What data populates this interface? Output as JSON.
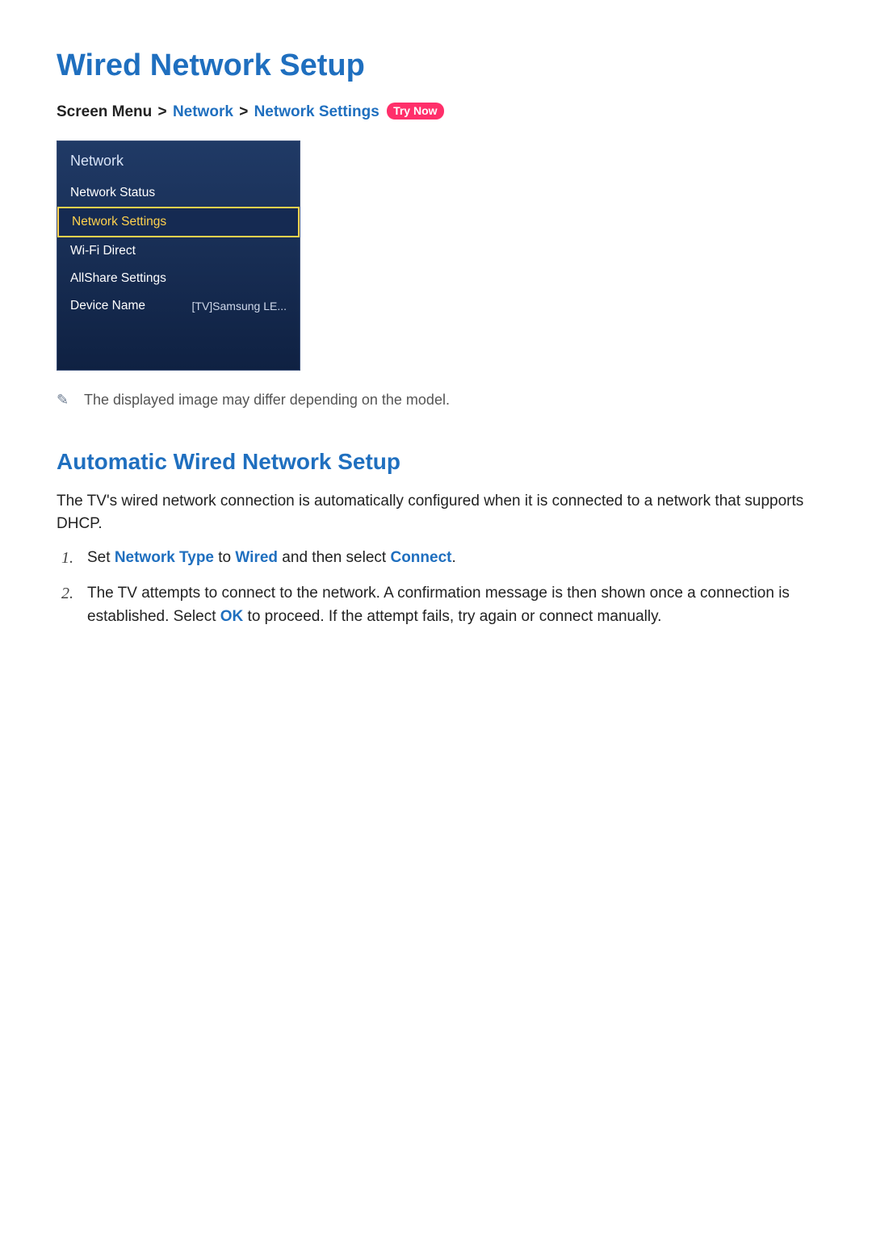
{
  "title": "Wired Network Setup",
  "breadcrumb": {
    "prefix": "Screen Menu",
    "sep": ">",
    "lvl1": "Network",
    "lvl2": "Network Settings",
    "try_now": "Try Now"
  },
  "menu": {
    "header": "Network",
    "items": [
      {
        "label": "Network Status",
        "value": "",
        "selected": false
      },
      {
        "label": "Network Settings",
        "value": "",
        "selected": true
      },
      {
        "label": "Wi-Fi Direct",
        "value": "",
        "selected": false
      },
      {
        "label": "AllShare Settings",
        "value": "",
        "selected": false
      },
      {
        "label": "Device Name",
        "value": "[TV]Samsung LE...",
        "selected": false
      }
    ]
  },
  "note": "The displayed image may differ depending on the model.",
  "section": {
    "heading": "Automatic Wired Network Setup",
    "intro": "The TV's wired network connection is automatically configured when it is connected to a network that supports DHCP.",
    "steps": {
      "s1": {
        "t1": "Set ",
        "k1": "Network Type",
        "t2": " to ",
        "k2": "Wired",
        "t3": " and then select ",
        "k3": "Connect",
        "t4": "."
      },
      "s2": {
        "t1": "The TV attempts to connect to the network. A confirmation message is then shown once a connection is established. Select ",
        "k1": "OK",
        "t2": " to proceed. If the attempt fails, try again or connect manually."
      }
    }
  }
}
